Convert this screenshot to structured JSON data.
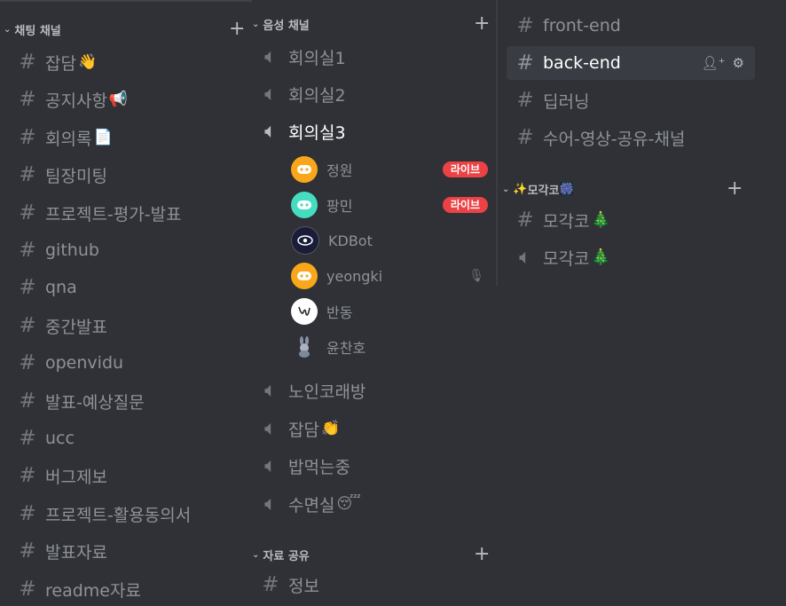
{
  "colors": {
    "background": "#2f3136",
    "selected": "#393c43",
    "live": "#ed4245",
    "text_muted": "#8e9297"
  },
  "left": {
    "category": "채팅 채널",
    "channels": [
      {
        "name": "잡담",
        "emoji": "👋"
      },
      {
        "name": "공지사항",
        "emoji": "📢"
      },
      {
        "name": "회의록",
        "emoji": "📄"
      },
      {
        "name": "팀장미팅",
        "emoji": ""
      },
      {
        "name": "프로젝트-평가-발표",
        "emoji": ""
      },
      {
        "name": "github",
        "emoji": ""
      },
      {
        "name": "qna",
        "emoji": ""
      },
      {
        "name": "중간발표",
        "emoji": ""
      },
      {
        "name": "openvidu",
        "emoji": ""
      },
      {
        "name": "발표-예상질문",
        "emoji": ""
      },
      {
        "name": "ucc",
        "emoji": ""
      },
      {
        "name": "버그제보",
        "emoji": ""
      },
      {
        "name": "프로젝트-활용동의서",
        "emoji": ""
      },
      {
        "name": "발표자료",
        "emoji": ""
      },
      {
        "name": "readme자료",
        "emoji": ""
      }
    ]
  },
  "middle": {
    "voice_category": "음성 채널",
    "voice1": "회의실1",
    "voice2": "회의실2",
    "voice3": "회의실3",
    "users": [
      {
        "name": "정원",
        "live": "라이브",
        "avatar": "discord-orange"
      },
      {
        "name": "팡민",
        "live": "라이브",
        "avatar": "discord-teal"
      },
      {
        "name": "KDBot",
        "live": "",
        "avatar": "bot-eye"
      },
      {
        "name": "yeongki",
        "live": "",
        "avatar": "discord-orange"
      },
      {
        "name": "반동",
        "live": "",
        "avatar": "signature"
      },
      {
        "name": "윤찬호",
        "live": "",
        "avatar": "rabbit"
      }
    ],
    "voice4": "노인코래방",
    "voice5": "잡담",
    "voice5_emoji": "👏",
    "voice6": "밥먹는중",
    "voice7": "수면실",
    "voice7_emoji": "😴",
    "share_category": "자료 공유",
    "share_channel": "정보"
  },
  "right": {
    "channels": [
      "front-end",
      "back-end",
      "딥러닝",
      "수어-영상-공유-채널"
    ],
    "category": "모각코",
    "category_emoji_left": "✨",
    "category_emoji_right": "🎆",
    "mogakko_text": "모각코",
    "mogakko_voice": "모각코",
    "tree_emoji": "🎄"
  }
}
